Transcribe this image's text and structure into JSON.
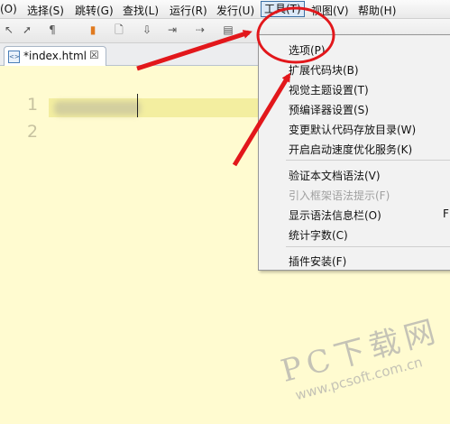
{
  "menubar": {
    "items": [
      {
        "label": "(O)"
      },
      {
        "label": "选择(S)"
      },
      {
        "label": "跳转(G)"
      },
      {
        "label": "查找(L)"
      },
      {
        "label": "运行(R)"
      },
      {
        "label": "发行(U)"
      },
      {
        "label": "工具(T)"
      },
      {
        "label": "视图(V)"
      },
      {
        "label": "帮助(H)"
      }
    ]
  },
  "toolbar": {
    "icons": [
      "back-icon",
      "forward-icon",
      "format-icon",
      "bookmark-icon",
      "new-file-icon",
      "save-icon",
      "run-icon",
      "step-icon",
      "preview-icon"
    ]
  },
  "tab": {
    "label": "*index.html",
    "close_glyph": "☒"
  },
  "editor": {
    "line_numbers": [
      "1",
      "2"
    ]
  },
  "tools_menu": {
    "items": [
      {
        "label": "选项(P)",
        "enabled": true
      },
      {
        "label": "扩展代码块(B)",
        "enabled": true
      },
      {
        "label": "视觉主题设置(T)",
        "enabled": true
      },
      {
        "label": "预编译器设置(S)",
        "enabled": true
      },
      {
        "label": "变更默认代码存放目录(W)",
        "enabled": true
      },
      {
        "label": "开启启动速度优化服务(K)",
        "enabled": true
      },
      {
        "label": "验证本文档语法(V)",
        "enabled": true
      },
      {
        "label": "引入框架语法提示(F)",
        "enabled": false
      },
      {
        "label": "显示语法信息栏(O)",
        "enabled": true,
        "shortcut": "F"
      },
      {
        "label": "统计字数(C)",
        "enabled": true
      },
      {
        "label": "插件安装(F)",
        "enabled": true
      }
    ]
  },
  "watermark": {
    "title": "PC下载网",
    "url": "www.pcsoft.com.cn"
  },
  "colors": {
    "editor_bg": "#fffbd0",
    "annotation_red": "#e2171b",
    "menu_active_border": "#3b6fa5"
  }
}
